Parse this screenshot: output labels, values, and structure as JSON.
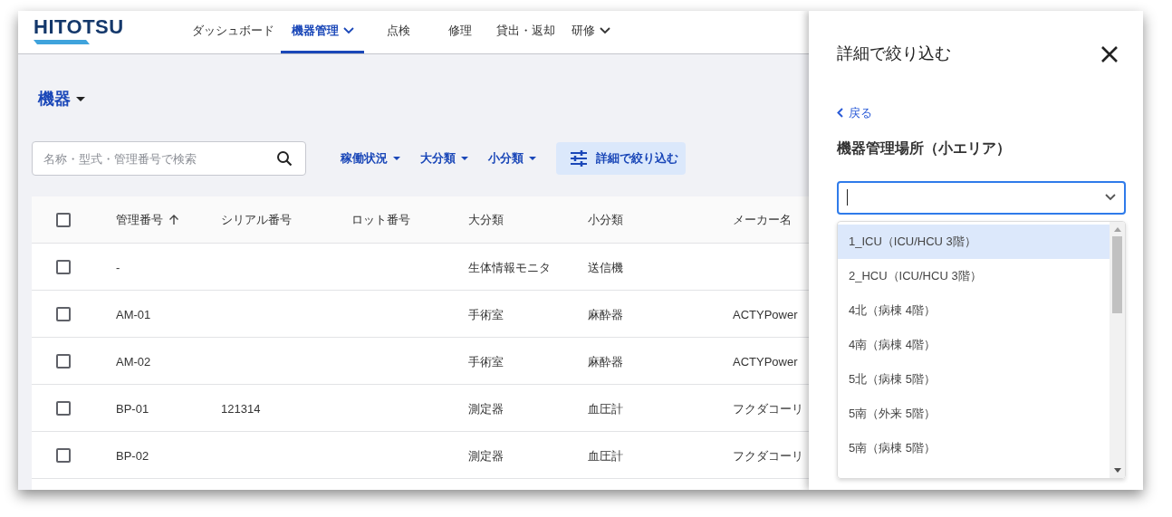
{
  "logo": "HITOTSU",
  "nav": [
    {
      "label": "ダッシュボード",
      "selected": false,
      "dropdown": false
    },
    {
      "label": "機器管理",
      "selected": true,
      "dropdown": true
    },
    {
      "label": "点検",
      "selected": false,
      "dropdown": false
    },
    {
      "label": "修理",
      "selected": false,
      "dropdown": false
    },
    {
      "label": "貸出・返却",
      "selected": false,
      "dropdown": false
    },
    {
      "label": "研修",
      "selected": false,
      "dropdown": true
    }
  ],
  "page_title": "機器",
  "search": {
    "placeholder": "名称・型式・管理番号で検索"
  },
  "filters": [
    {
      "label": "稼働状況",
      "kind": "dropdown"
    },
    {
      "label": "大分類",
      "kind": "dropdown"
    },
    {
      "label": "小分類",
      "kind": "dropdown"
    },
    {
      "label": "詳細で絞り込む",
      "kind": "advanced"
    }
  ],
  "table": {
    "select_all": {
      "checked": false
    },
    "columns": [
      {
        "label": "管理番号",
        "sorted": true
      },
      {
        "label": "シリアル番号",
        "sorted": false
      },
      {
        "label": "ロット番号",
        "sorted": false
      },
      {
        "label": "大分類",
        "sorted": false
      },
      {
        "label": "小分類",
        "sorted": false
      },
      {
        "label": "メーカー名",
        "sorted": false
      }
    ],
    "rows": [
      {
        "checked": false,
        "cells": [
          "-",
          null,
          null,
          "生体情報モニタ",
          "送信機",
          null
        ]
      },
      {
        "checked": false,
        "cells": [
          "AM-01",
          null,
          null,
          "手術室",
          "麻酔器",
          "ACTYPower"
        ]
      },
      {
        "checked": false,
        "cells": [
          "AM-02",
          null,
          null,
          "手術室",
          "麻酔器",
          "ACTYPower"
        ]
      },
      {
        "checked": false,
        "cells": [
          "BP-01",
          "121314",
          null,
          "測定器",
          "血圧計",
          "フクダコーリ"
        ]
      },
      {
        "checked": false,
        "cells": [
          "BP-02",
          null,
          null,
          "測定器",
          "血圧計",
          "フクダコーリ"
        ]
      }
    ]
  },
  "panel": {
    "title": "詳細で絞り込む",
    "back": "戻る",
    "field_label": "機器管理場所（小エリア）",
    "options": [
      {
        "label": "1_ICU（ICU/HCU 3階）",
        "selected": true
      },
      {
        "label": "2_HCU（ICU/HCU 3階）",
        "selected": false
      },
      {
        "label": "4北（病棟 4階）",
        "selected": false
      },
      {
        "label": "4南（病棟 4階）",
        "selected": false
      },
      {
        "label": "5北（病棟 5階）",
        "selected": false
      },
      {
        "label": "5南（外来 5階）",
        "selected": false
      },
      {
        "label": "5南（病棟 5階）",
        "selected": false
      }
    ]
  }
}
